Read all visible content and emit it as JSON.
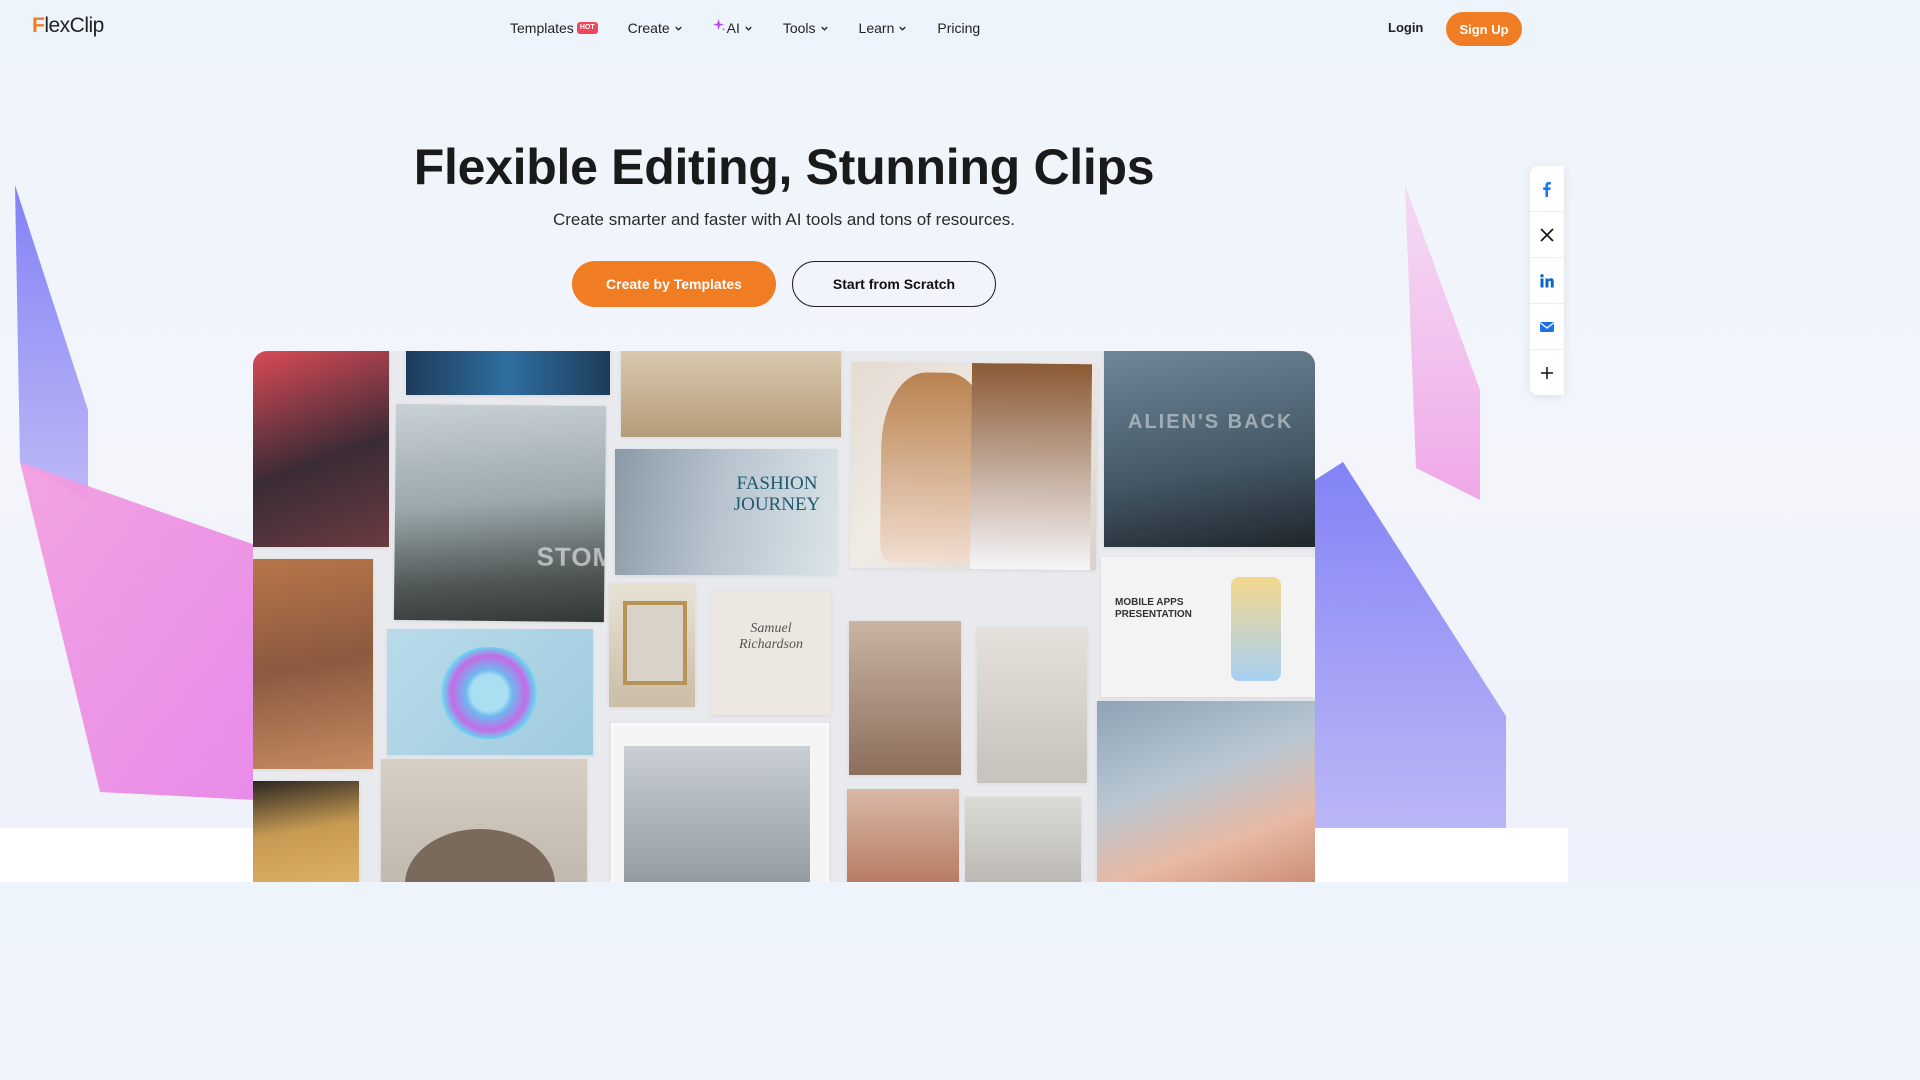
{
  "header": {
    "logo": {
      "accent": "F",
      "rest": "lexClip"
    },
    "nav": [
      {
        "label": "Templates",
        "badge": "HOT",
        "icon": null,
        "chevron": false
      },
      {
        "label": "Create",
        "badge": null,
        "icon": null,
        "chevron": true
      },
      {
        "label": "AI",
        "badge": null,
        "icon": "sparkle-icon",
        "chevron": true
      },
      {
        "label": "Tools",
        "badge": null,
        "icon": null,
        "chevron": true
      },
      {
        "label": "Learn",
        "badge": null,
        "icon": null,
        "chevron": true
      },
      {
        "label": "Pricing",
        "badge": null,
        "icon": null,
        "chevron": false
      }
    ],
    "login_label": "Login",
    "signup_label": "Sign Up"
  },
  "hero": {
    "title": "Flexible Editing, Stunning Clips",
    "subtitle": "Create smarter and faster with AI tools and tons of resources.",
    "primary_button": "Create by Templates",
    "secondary_button": "Start from Scratch"
  },
  "share": [
    "facebook-icon",
    "x-icon",
    "linkedin-icon",
    "mail-icon",
    "plus-icon"
  ],
  "collage": {
    "stomp_text": "STOMP",
    "fashion_text": "FASHION JOURNEY",
    "samuel_text": "Samuel Richardson",
    "alien_text": "ALIEN'S BACK",
    "mobile_text": "MOBILE APPS PRESENTATION"
  },
  "colors": {
    "accent": "#f07c24",
    "hot": "#f0455b",
    "ai_sparkle": "#b44cf0"
  }
}
